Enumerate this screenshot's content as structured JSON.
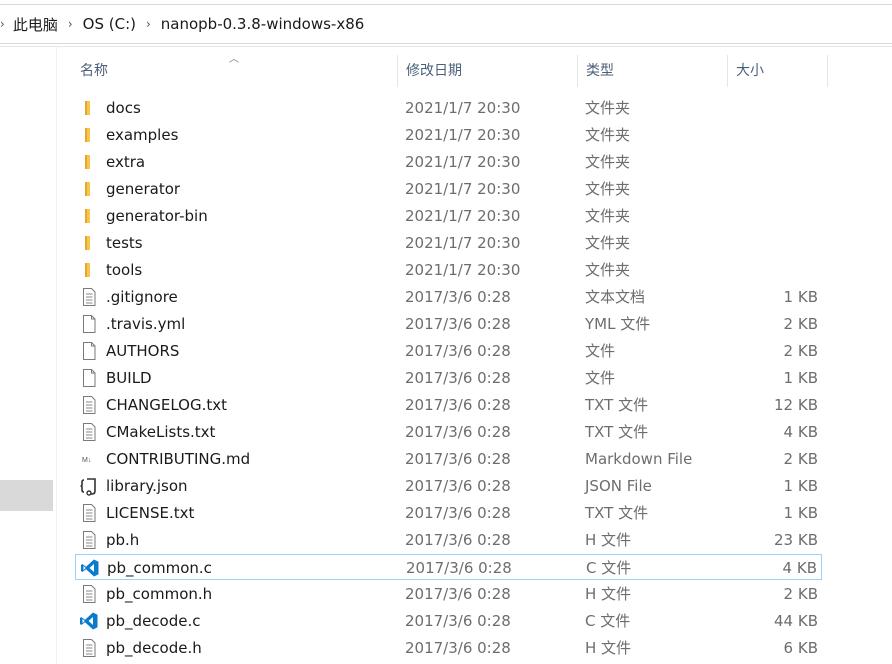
{
  "breadcrumb": {
    "items": [
      "此电脑",
      "OS (C:)",
      "nanopb-0.3.8-windows-x86"
    ]
  },
  "columns": {
    "name": "名称",
    "date": "修改日期",
    "type": "类型",
    "size": "大小"
  },
  "files": [
    {
      "name": "docs",
      "date": "2021/1/7 20:30",
      "type": "文件夹",
      "size": "",
      "icon": "folder-icon"
    },
    {
      "name": "examples",
      "date": "2021/1/7 20:30",
      "type": "文件夹",
      "size": "",
      "icon": "folder-icon"
    },
    {
      "name": "extra",
      "date": "2021/1/7 20:30",
      "type": "文件夹",
      "size": "",
      "icon": "folder-icon"
    },
    {
      "name": "generator",
      "date": "2021/1/7 20:30",
      "type": "文件夹",
      "size": "",
      "icon": "folder-icon"
    },
    {
      "name": "generator-bin",
      "date": "2021/1/7 20:30",
      "type": "文件夹",
      "size": "",
      "icon": "folder-icon"
    },
    {
      "name": "tests",
      "date": "2021/1/7 20:30",
      "type": "文件夹",
      "size": "",
      "icon": "folder-icon"
    },
    {
      "name": "tools",
      "date": "2021/1/7 20:30",
      "type": "文件夹",
      "size": "",
      "icon": "folder-icon"
    },
    {
      "name": ".gitignore",
      "date": "2017/3/6 0:28",
      "type": "文本文档",
      "size": "1 KB",
      "icon": "text-document-icon"
    },
    {
      "name": ".travis.yml",
      "date": "2017/3/6 0:28",
      "type": "YML 文件",
      "size": "2 KB",
      "icon": "blank-file-icon"
    },
    {
      "name": "AUTHORS",
      "date": "2017/3/6 0:28",
      "type": "文件",
      "size": "2 KB",
      "icon": "blank-file-icon"
    },
    {
      "name": "BUILD",
      "date": "2017/3/6 0:28",
      "type": "文件",
      "size": "1 KB",
      "icon": "blank-file-icon"
    },
    {
      "name": "CHANGELOG.txt",
      "date": "2017/3/6 0:28",
      "type": "TXT 文件",
      "size": "12 KB",
      "icon": "text-document-icon"
    },
    {
      "name": "CMakeLists.txt",
      "date": "2017/3/6 0:28",
      "type": "TXT 文件",
      "size": "4 KB",
      "icon": "text-document-icon"
    },
    {
      "name": "CONTRIBUTING.md",
      "date": "2017/3/6 0:28",
      "type": "Markdown File",
      "size": "2 KB",
      "icon": "markdown-file-icon"
    },
    {
      "name": "library.json",
      "date": "2017/3/6 0:28",
      "type": "JSON File",
      "size": "1 KB",
      "icon": "json-file-icon"
    },
    {
      "name": "LICENSE.txt",
      "date": "2017/3/6 0:28",
      "type": "TXT 文件",
      "size": "1 KB",
      "icon": "text-document-icon"
    },
    {
      "name": "pb.h",
      "date": "2017/3/6 0:28",
      "type": "H 文件",
      "size": "23 KB",
      "icon": "text-document-icon"
    },
    {
      "name": "pb_common.c",
      "date": "2017/3/6 0:28",
      "type": "C 文件",
      "size": "4 KB",
      "icon": "vscode-icon",
      "selected": true
    },
    {
      "name": "pb_common.h",
      "date": "2017/3/6 0:28",
      "type": "H 文件",
      "size": "2 KB",
      "icon": "text-document-icon"
    },
    {
      "name": "pb_decode.c",
      "date": "2017/3/6 0:28",
      "type": "C 文件",
      "size": "44 KB",
      "icon": "vscode-icon"
    },
    {
      "name": "pb_decode.h",
      "date": "2017/3/6 0:28",
      "type": "H 文件",
      "size": "6 KB",
      "icon": "text-document-icon"
    }
  ],
  "colors": {
    "folder": "#f8c64a",
    "selection_border": "#99d1ff",
    "header_text": "#4c607a",
    "vscode_blue": "#0a7acc"
  }
}
